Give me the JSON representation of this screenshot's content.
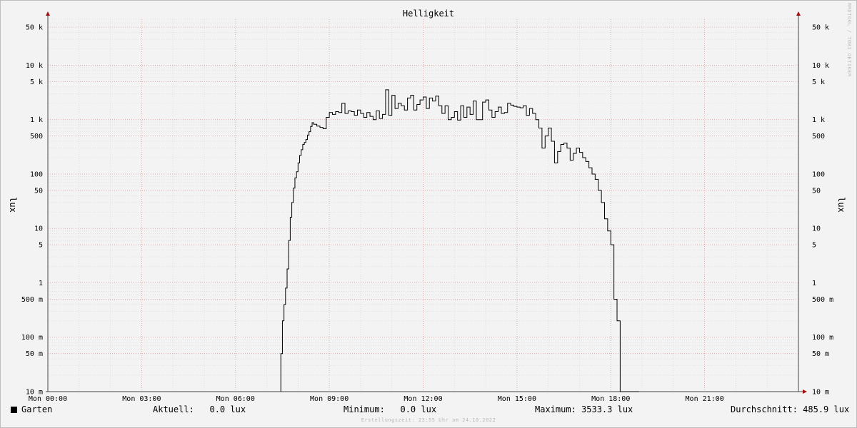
{
  "chart_data": {
    "type": "line",
    "title": "Helligkeit",
    "ylabel": "lux",
    "yscale": "log",
    "ylim": [
      0.01,
      70000
    ],
    "xlim": [
      0,
      24
    ],
    "x_ticks": [
      {
        "value": 0,
        "label": "Mon 00:00"
      },
      {
        "value": 3,
        "label": "Mon 03:00"
      },
      {
        "value": 6,
        "label": "Mon 06:00"
      },
      {
        "value": 9,
        "label": "Mon 09:00"
      },
      {
        "value": 12,
        "label": "Mon 12:00"
      },
      {
        "value": 15,
        "label": "Mon 15:00"
      },
      {
        "value": 18,
        "label": "Mon 18:00"
      },
      {
        "value": 21,
        "label": "Mon 21:00"
      }
    ],
    "y_ticks": [
      {
        "value": 0.01,
        "label": "10 m"
      },
      {
        "value": 0.05,
        "label": "50 m"
      },
      {
        "value": 0.1,
        "label": "100 m"
      },
      {
        "value": 0.5,
        "label": "500 m"
      },
      {
        "value": 1,
        "label": "1"
      },
      {
        "value": 5,
        "label": "5"
      },
      {
        "value": 10,
        "label": "10"
      },
      {
        "value": 50,
        "label": "50"
      },
      {
        "value": 100,
        "label": "100"
      },
      {
        "value": 500,
        "label": "500"
      },
      {
        "value": 1000,
        "label": "1 k"
      },
      {
        "value": 5000,
        "label": "5 k"
      },
      {
        "value": 10000,
        "label": "10 k"
      },
      {
        "value": 50000,
        "label": "50 k"
      }
    ],
    "grid": true,
    "series": [
      {
        "name": "Garten",
        "color": "#000000",
        "x": [
          7.45,
          7.5,
          7.55,
          7.6,
          7.65,
          7.7,
          7.75,
          7.8,
          7.85,
          7.9,
          7.95,
          8.0,
          8.05,
          8.1,
          8.15,
          8.2,
          8.25,
          8.3,
          8.35,
          8.4,
          8.45,
          8.5,
          8.6,
          8.7,
          8.8,
          8.9,
          9.0,
          9.1,
          9.2,
          9.3,
          9.4,
          9.5,
          9.6,
          9.7,
          9.8,
          9.9,
          10.0,
          10.1,
          10.2,
          10.3,
          10.4,
          10.5,
          10.6,
          10.7,
          10.8,
          10.9,
          11.0,
          11.1,
          11.2,
          11.3,
          11.4,
          11.5,
          11.6,
          11.7,
          11.8,
          11.9,
          12.0,
          12.1,
          12.2,
          12.3,
          12.4,
          12.5,
          12.6,
          12.7,
          12.8,
          12.9,
          13.0,
          13.1,
          13.2,
          13.3,
          13.4,
          13.5,
          13.6,
          13.7,
          13.8,
          13.9,
          14.0,
          14.1,
          14.2,
          14.3,
          14.4,
          14.5,
          14.6,
          14.7,
          14.8,
          14.9,
          15.0,
          15.1,
          15.2,
          15.3,
          15.4,
          15.5,
          15.6,
          15.7,
          15.8,
          15.9,
          16.0,
          16.1,
          16.2,
          16.3,
          16.4,
          16.5,
          16.6,
          16.7,
          16.8,
          16.9,
          17.0,
          17.1,
          17.2,
          17.3,
          17.4,
          17.5,
          17.6,
          17.7,
          17.8,
          17.9,
          18.0,
          18.1,
          18.2,
          18.3,
          18.4,
          18.5,
          18.6,
          18.7,
          18.75,
          18.8,
          18.85,
          18.9
        ],
        "y": [
          0.05,
          0.2,
          0.4,
          0.8,
          1.8,
          6.0,
          16,
          30,
          55,
          85,
          110,
          160,
          220,
          280,
          350,
          380,
          430,
          520,
          600,
          750,
          880,
          820,
          760,
          720,
          680,
          1100,
          1350,
          1250,
          1400,
          1350,
          2000,
          1300,
          1450,
          1400,
          1200,
          1500,
          1300,
          1100,
          1350,
          1150,
          1000,
          1450,
          1050,
          1250,
          3533.3,
          1200,
          2800,
          1600,
          2000,
          1800,
          1500,
          2500,
          2800,
          1500,
          1900,
          2300,
          2600,
          1600,
          2500,
          2200,
          2700,
          1800,
          1300,
          1800,
          1000,
          1100,
          1400,
          980,
          1800,
          1100,
          1700,
          1250,
          2200,
          1000,
          1000,
          2100,
          2300,
          1500,
          1100,
          1400,
          1700,
          1300,
          1350,
          2000,
          1850,
          1750,
          1700,
          1650,
          1800,
          1200,
          1600,
          1300,
          1000,
          700,
          300,
          500,
          700,
          400,
          160,
          260,
          350,
          370,
          300,
          180,
          240,
          300,
          250,
          200,
          170,
          130,
          100,
          80,
          50,
          30,
          15,
          9,
          5,
          0.5,
          0.2,
          0.01,
          0.01,
          0.01,
          0.01,
          0.01,
          0.01,
          0.01,
          0.01,
          0.01
        ]
      }
    ]
  },
  "legend": {
    "series_name": "Garten",
    "current": "Aktuell:   0.0 lux",
    "minimum": "Minimum:   0.0 lux",
    "maximum": "Maximum: 3533.3 lux",
    "average": "Durchschnitt: 485.9 lux"
  },
  "footer": "Erstellungszeit: 23:55 Uhr am 24.10.2022",
  "watermark": "RRDTOOL / TOBI OETIKER"
}
